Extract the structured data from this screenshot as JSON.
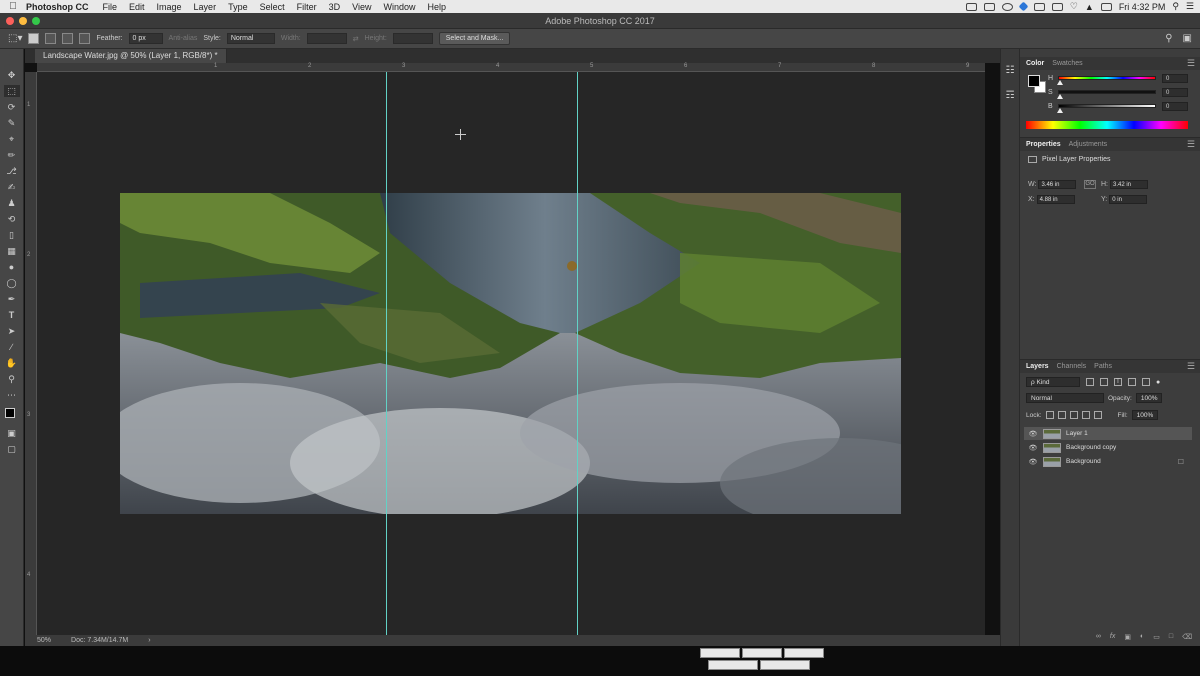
{
  "menubar": {
    "app_name": "Photoshop CC",
    "items": [
      "File",
      "Edit",
      "Image",
      "Layer",
      "Type",
      "Select",
      "Filter",
      "3D",
      "View",
      "Window",
      "Help"
    ],
    "clock": "Fri 4:32 PM"
  },
  "window": {
    "title": "Adobe Photoshop CC 2017"
  },
  "options": {
    "feather_label": "Feather:",
    "feather_value": "0 px",
    "antialias_label": "Anti-alias",
    "style_label": "Style:",
    "style_value": "Normal",
    "width_label": "Width:",
    "height_label": "Height:",
    "select_mask_label": "Select and Mask..."
  },
  "document": {
    "tab_title": "Landscape Water.jpg @ 50% (Layer 1, RGB/8*) *",
    "ruler_h": [
      "1",
      "2",
      "3",
      "4",
      "5",
      "6",
      "7",
      "8",
      "9"
    ],
    "ruler_v": [
      "1",
      "2",
      "3",
      "4"
    ],
    "zoom": "50%",
    "doc_size": "Doc: 7.34M/14.7M"
  },
  "color_panel": {
    "tabs": [
      "Color",
      "Swatches"
    ],
    "sliders": [
      {
        "label": "H",
        "value": "0"
      },
      {
        "label": "S",
        "value": "0"
      },
      {
        "label": "B",
        "value": "0"
      }
    ]
  },
  "properties_panel": {
    "tabs": [
      "Properties",
      "Adjustments"
    ],
    "title": "Pixel Layer Properties",
    "w_label": "W:",
    "w_value": "3.46 in",
    "h_label": "H:",
    "h_value": "3.42 in",
    "x_label": "X:",
    "x_value": "4.88 in",
    "y_label": "Y:",
    "y_value": "0 in",
    "link_glyph": "GO"
  },
  "layers_panel": {
    "tabs": [
      "Layers",
      "Channels",
      "Paths"
    ],
    "kind_label": "ρ Kind",
    "blend_mode": "Normal",
    "opacity_label": "Opacity:",
    "opacity_value": "100%",
    "lock_label": "Lock:",
    "fill_label": "Fill:",
    "fill_value": "100%",
    "layers": [
      {
        "name": "Layer 1",
        "selected": true,
        "locked": false
      },
      {
        "name": "Background copy",
        "selected": false,
        "locked": false
      },
      {
        "name": "Background",
        "selected": false,
        "locked": true
      }
    ],
    "bottom_icons": [
      "link-icon",
      "fx-icon",
      "mask-icon",
      "adjustment-icon",
      "folder-icon",
      "new-layer-icon",
      "trash-icon"
    ]
  },
  "colors": {
    "guide": "#62d2c6",
    "canvas_bg": "#262626",
    "panel_bg": "#3d3d3d"
  }
}
